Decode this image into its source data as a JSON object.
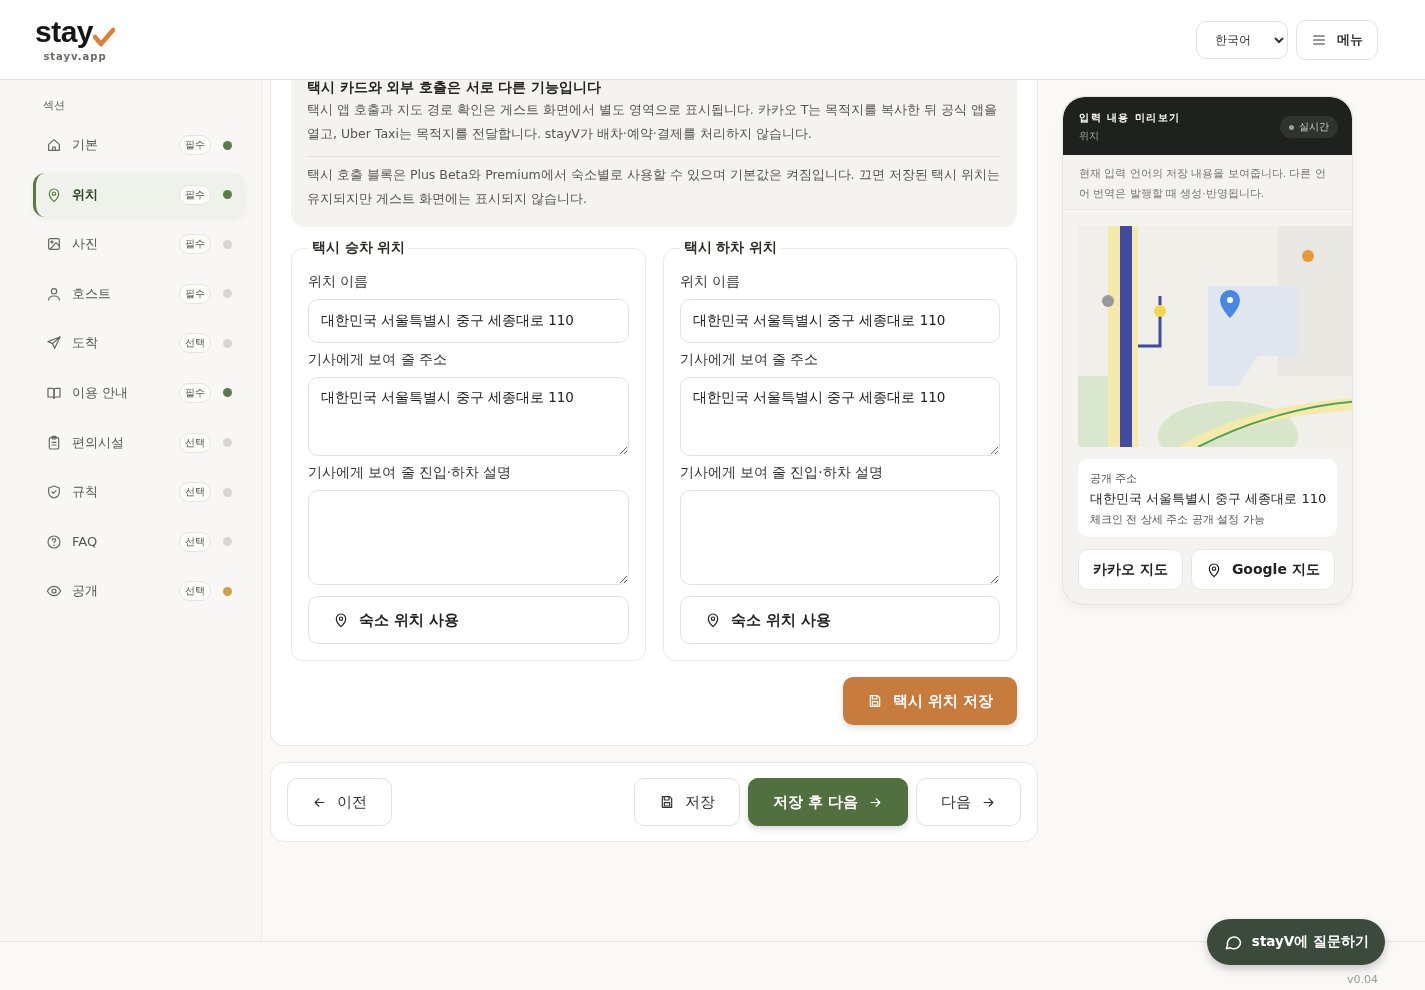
{
  "header": {
    "logo": "stay",
    "domain": "stayv.app",
    "language": "한국어",
    "menu_button": "메뉴"
  },
  "sidebar": {
    "heading": "섹션",
    "items": [
      {
        "label": "기본",
        "badge": "필수",
        "color": "#5c7a4a",
        "selected": false
      },
      {
        "label": "위치",
        "badge": "필수",
        "color": "#5c7a4a",
        "selected": true
      },
      {
        "label": "사진",
        "badge": "필수",
        "color": "#d6d6d4",
        "selected": false
      },
      {
        "label": "호스트",
        "badge": "필수",
        "color": "#d6d6d4",
        "selected": false
      },
      {
        "label": "도착",
        "badge": "선택",
        "color": "#d6d6d4",
        "selected": false
      },
      {
        "label": "이용 안내",
        "badge": "필수",
        "color": "#5c7a4a",
        "selected": false
      },
      {
        "label": "편의시설",
        "badge": "선택",
        "color": "#d6d6d4",
        "selected": false
      },
      {
        "label": "규칙",
        "badge": "선택",
        "color": "#d6d6d4",
        "selected": false
      },
      {
        "label": "FAQ",
        "badge": "선택",
        "color": "#d6d6d4",
        "selected": false
      },
      {
        "label": "공개",
        "badge": "선택",
        "color": "#c9a24a",
        "selected": false
      }
    ]
  },
  "notice": {
    "title": "택시 카드와 외부 호출은 서로 다른 기능입니다",
    "paragraphs": [
      "택시 앱 호출과 지도 경로 확인은 게스트 화면에서 별도 영역으로 표시됩니다. 카카오 T는 목적지를 복사한 뒤 공식 앱을 열고, Uber Taxi는 목적지를 전달합니다. stayV가 배차·예약·결제를 처리하지 않습니다.",
      "택시 호출 블록은 Plus Beta와 Premium에서 숙소별로 사용할 수 있으며 기본값은 켜짐입니다. 끄면 저장된 택시 위치는 유지되지만 게스트 화면에는 표시되지 않습니다."
    ]
  },
  "groups": [
    {
      "legend": "택시 승차 위치",
      "fields": [
        {
          "label": "위치 이름",
          "kind": "input",
          "value": "대한민국 서울특별시 중구 세종대로 110"
        },
        {
          "label": "기사에게 보여 줄 주소",
          "kind": "textarea",
          "value": "대한민국 서울특별시 중구 세종대로 110"
        },
        {
          "label": "기사에게 보여 줄 진입·하차 설명",
          "kind": "textarea"
        }
      ],
      "button": "숙소 위치 사용"
    },
    {
      "legend": "택시 하차 위치",
      "fields": [
        {
          "label": "위치 이름",
          "kind": "input",
          "value": "대한민국 서울특별시 중구 세종대로 110"
        },
        {
          "label": "기사에게 보여 줄 주소",
          "kind": "textarea",
          "value": "대한민국 서울특별시 중구 세종대로 110"
        },
        {
          "label": "기사에게 보여 줄 진입·하차 설명",
          "kind": "textarea"
        }
      ],
      "button": "숙소 위치 사용"
    }
  ],
  "save_button": "택시 위치 저장",
  "nav": {
    "previous": "이전",
    "save": "저장",
    "save_next": "저장 후 다음",
    "next": "다음"
  },
  "preview": {
    "title": "입력 내용 미리보기",
    "subtitle": "위치",
    "badge": "실시간",
    "note": "현재 입력 언어의 저장 내용을 보여줍니다. 다른 언어 번역은 발행할 때 생성·반영됩니다.",
    "map": {
      "kind": "picture"
    },
    "address": {
      "label": "공개 주소",
      "value": "대한민국 서울특별시 중구 세종대로 110",
      "note": "체크인 전 상세 주소 공개 설정 가능"
    },
    "buttons": [
      "카카오 지도",
      "Google 지도"
    ]
  },
  "chat_button": "stayV에 질문하기",
  "version": "v0.04"
}
